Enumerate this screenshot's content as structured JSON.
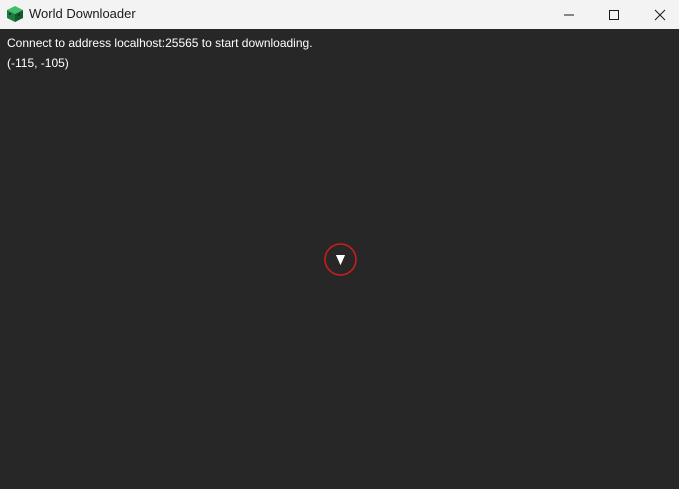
{
  "window": {
    "title": "World Downloader",
    "controls": {
      "minimize_icon": "minimize-icon",
      "maximize_icon": "maximize-icon",
      "close_icon": "close-icon"
    }
  },
  "status": {
    "connect_message": "Connect to address localhost:25565 to start downloading.",
    "coordinates": "(-115, -105)"
  },
  "player_marker": {
    "icon": "player-arrow-icon",
    "ring_color": "#c81e1e",
    "arrow_color": "#ffffff"
  },
  "colors": {
    "background": "#272727",
    "titlebar": "#f3f3f3"
  }
}
